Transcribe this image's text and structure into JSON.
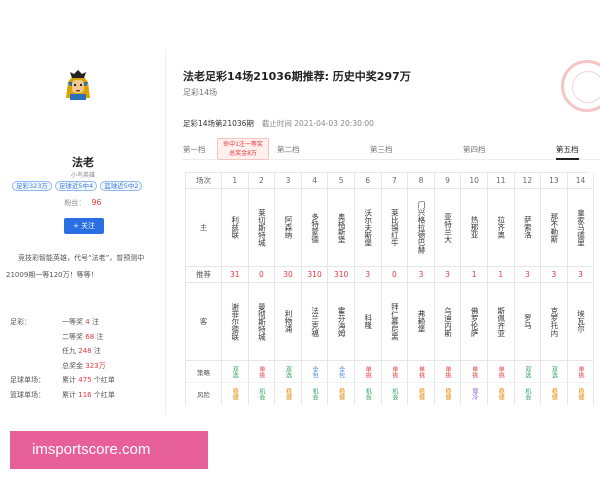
{
  "author": {
    "name": "法老",
    "title": "小鸟英雄",
    "tags": [
      "足彩323万",
      "足球近5中4",
      "篮球近5中2"
    ],
    "fans_label": "粉丝：",
    "fans_count": "96",
    "follow_label": "+ 关注",
    "intro": "竞技彩智能英雄，代号“法老”，曾预测中21009期一等120万！等等！",
    "stats": [
      {
        "key": "足彩：",
        "prefix": "一等奖",
        "value": "4",
        "suffix": "注"
      },
      {
        "key": "",
        "prefix": "二等奖",
        "value": "68",
        "suffix": "注"
      },
      {
        "key": "",
        "prefix": "任九",
        "value": "248",
        "suffix": "注"
      },
      {
        "key": "",
        "prefix": "总奖金",
        "value": "323万",
        "suffix": ""
      },
      {
        "key": "足球单场：",
        "prefix": "累计",
        "value": "475",
        "suffix": "个红单"
      },
      {
        "key": "篮球单场：",
        "prefix": "累计",
        "value": "116",
        "suffix": "个红单"
      }
    ]
  },
  "article": {
    "title": "法老足彩14场21036期推荐: 历史中奖297万",
    "subtitle": "足彩14场",
    "period": "足彩14场第21036期",
    "deadline": "截止时间 2021-04-03 20:30:00"
  },
  "tabs": [
    {
      "label": "第一档",
      "active": false
    },
    {
      "label": "第二档",
      "active": false
    },
    {
      "label": "第三档",
      "active": false
    },
    {
      "label": "第四档",
      "active": false
    },
    {
      "label": "第五档",
      "active": true
    }
  ],
  "bubble": {
    "line1": "命中1注一等奖",
    "line2": "总奖金8万"
  },
  "grid": {
    "labels": {
      "match": "场次",
      "home": "主",
      "rec": "推荐",
      "away": "客",
      "strategy": "策略",
      "risk": "风险"
    },
    "matches": [
      {
        "no": "1",
        "home": "利兹联",
        "rec": "31",
        "away": "谢菲尔德联",
        "strategy": "双选",
        "risk": "稳健"
      },
      {
        "no": "2",
        "home": "莱切斯特城",
        "rec": "0",
        "away": "曼彻斯特城",
        "strategy": "单挑",
        "risk": "机会"
      },
      {
        "no": "3",
        "home": "阿森纳",
        "rec": "30",
        "away": "利物浦",
        "strategy": "双选",
        "risk": "稳健"
      },
      {
        "no": "4",
        "home": "多特蒙德",
        "rec": "310",
        "away": "法兰克福",
        "strategy": "全包",
        "risk": "机会"
      },
      {
        "no": "5",
        "home": "奥格斯堡",
        "rec": "310",
        "away": "霍芬海姆",
        "strategy": "全包",
        "risk": "稳健"
      },
      {
        "no": "6",
        "home": "沃尔夫斯堡",
        "rec": "3",
        "away": "科隆",
        "strategy": "单挑",
        "risk": "机会"
      },
      {
        "no": "7",
        "home": "莱比锡红牛",
        "rec": "0",
        "away": "拜仁慕尼黑",
        "strategy": "单挑",
        "risk": "机会"
      },
      {
        "no": "8",
        "home": "门兴格拉德巴赫",
        "rec": "3",
        "away": "弗赖堡",
        "strategy": "单挑",
        "risk": "稳健"
      },
      {
        "no": "9",
        "home": "亚特兰大",
        "rec": "3",
        "away": "乌迪内斯",
        "strategy": "单挑",
        "risk": "稳健"
      },
      {
        "no": "10",
        "home": "热那亚",
        "rec": "1",
        "away": "佛罗伦萨",
        "strategy": "单挑",
        "risk": "博冷"
      },
      {
        "no": "11",
        "home": "拉齐奥",
        "rec": "1",
        "away": "斯佩齐亚",
        "strategy": "单挑",
        "risk": "稳健"
      },
      {
        "no": "12",
        "home": "萨索洛",
        "rec": "3",
        "away": "罗马",
        "strategy": "双选",
        "risk": "机会"
      },
      {
        "no": "13",
        "home": "那不勒斯",
        "rec": "3",
        "away": "克罗托内",
        "strategy": "双选",
        "risk": "稳健"
      },
      {
        "no": "14",
        "home": "皇家马德里",
        "rec": "3",
        "away": "埃瓦尔",
        "strategy": "单挑",
        "risk": "稳健"
      }
    ]
  },
  "watermark": "imsportscore.com",
  "colors": {
    "accent": "#2a6ee3",
    "red": "#e4393c",
    "banner": "#e8609a",
    "green": "#2a9d5a",
    "orange": "#e08a00"
  }
}
